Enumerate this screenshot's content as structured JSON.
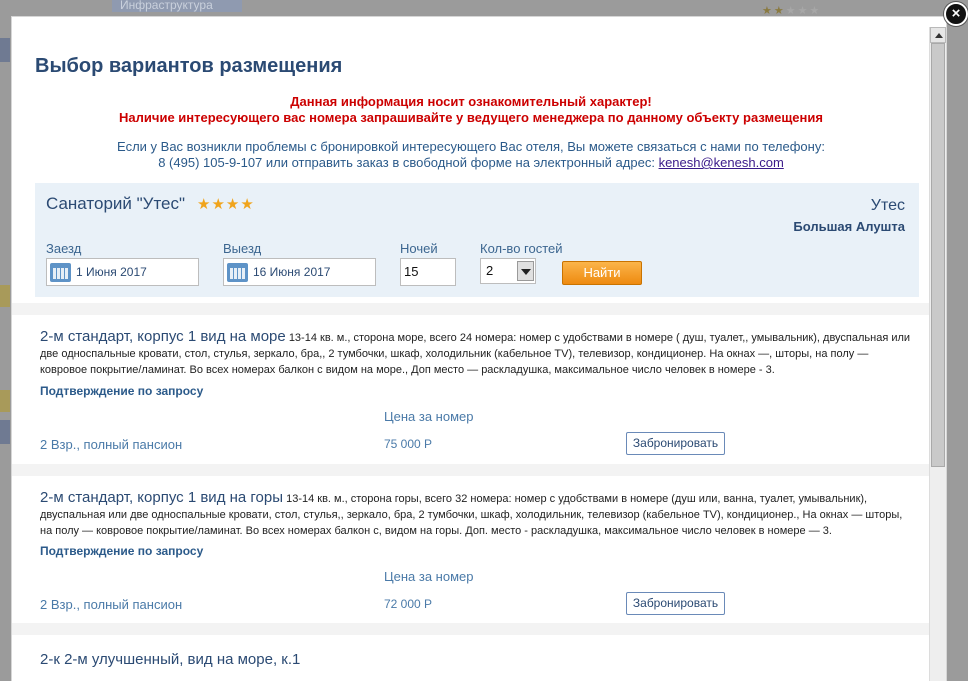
{
  "background": {
    "tab_label": "Инфраструктура",
    "stars": [
      "★",
      "★",
      "★",
      "★",
      "★"
    ]
  },
  "modal": {
    "close_glyph": "×",
    "title": "Выбор вариантов размещения",
    "notice_red_1": "Данная информация носит ознакомительный характер!",
    "notice_red_2": "Наличие интересующего вас номера запрашивайте у ведущего менеджера по данному объекту размещения",
    "notice_blue_1": "Если у Вас возникли проблемы с бронировкой интересующего Вас отеля, Вы можете связаться с нами по телефону:",
    "notice_blue_2": "8 (495) 105-9-107 или отправить заказ в свободной форме на электронный адрес:",
    "email": "kenesh@kenesh.com"
  },
  "search": {
    "hotel_name": "Санаторий \"Утес\"",
    "hotel_stars": "★★★★",
    "city": "Утес",
    "region": "Большая Алушта",
    "checkin_label": "Заезд",
    "checkin_value": "1 Июня 2017",
    "checkout_label": "Выезд",
    "checkout_value": "16 Июня 2017",
    "nights_label": "Ночей",
    "nights_value": "15",
    "guests_label": "Кол-во гостей",
    "guests_value": "2",
    "find_label": "Найти"
  },
  "rooms": [
    {
      "title": "2-м стандарт, корпус 1 вид на море",
      "description": "13-14 кв. м., сторона море, всего 24 номера: номер с удобствами в номере ( душ, туалет,, умывальник), двуспальная или две односпальные кровати, стол, стулья, зеркало, бра,, 2 тумбочки, шкаф, холодильник (кабельное TV), телевизор, кондиционер. На окнах —, шторы, на полу — ковровое покрытие/ламинат. Во всех номерах балкон с видом на море., Доп место — раскладушка, максимальное число человек в номере - 3.",
      "confirmation": "Подтверждение по запросу",
      "price_header": "Цена за номер",
      "tariff": "2 Взр., полный пансион",
      "price": "75 000 Р",
      "book_label": "Забронировать"
    },
    {
      "title": "2-м стандарт, корпус 1 вид на горы",
      "description": "13-14 кв. м., сторона горы, всего 32 номера: номер с удобствами в номере (душ или, ванна, туалет, умывальник), двуспальная или две односпальные кровати, стол, стулья,, зеркало, бра, 2 тумбочки, шкаф, холодильник, телевизор (кабельное TV), кондиционер., На окнах — шторы, на полу — ковровое покрытие/ламинат. Во всех номерах балкон с, видом на горы. Доп. место - раскладушка, максимальное число человек в номере — 3.",
      "confirmation": "Подтверждение по запросу",
      "price_header": "Цена за номер",
      "tariff": "2 Взр., полный пансион",
      "price": "72 000 Р",
      "book_label": "Забронировать"
    },
    {
      "title": "2-к 2-м улучшенный, вид на море, к.1"
    }
  ]
}
